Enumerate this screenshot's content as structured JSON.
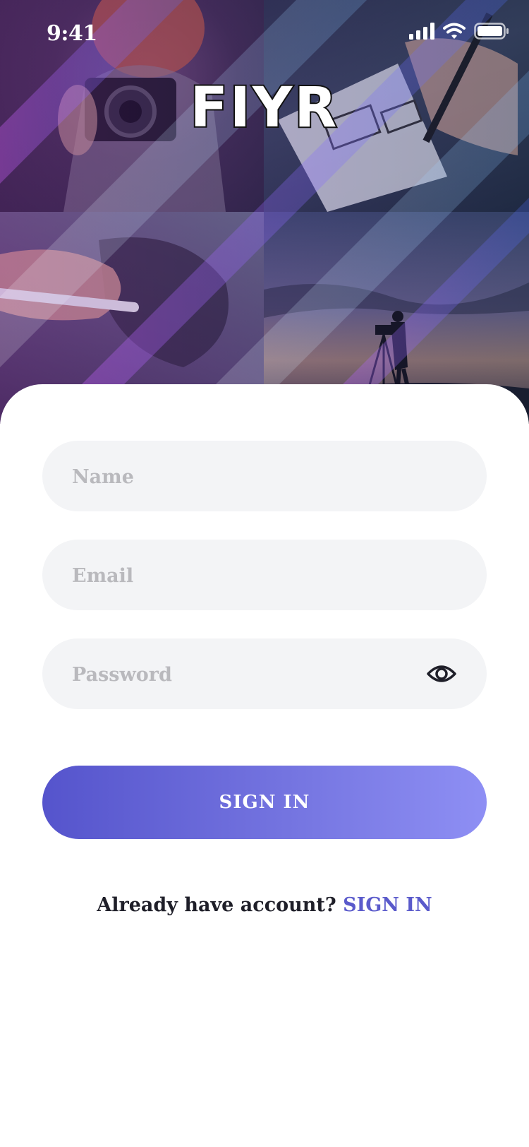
{
  "status_bar": {
    "time": "9:41",
    "icons": [
      "cellular-signal-icon",
      "wifi-icon",
      "battery-icon"
    ]
  },
  "hero": {
    "app_name": "FIYR",
    "photos": [
      "photographer-with-camera",
      "hand-sketching-wireframe",
      "hand-drawing-on-tablet",
      "silhouette-camera-tripod-sunset"
    ]
  },
  "form": {
    "name_placeholder": "Name",
    "email_placeholder": "Email",
    "password_placeholder": "Password",
    "show_password_icon": "eye-icon",
    "submit_label": "SIGN IN"
  },
  "footer": {
    "prompt": "Already have account?",
    "link_label": "SIGN IN"
  },
  "colors": {
    "accent": "#5a5acb",
    "button_gradient_start": "#5554cc",
    "button_gradient_end": "#8e8ff4",
    "field_background": "#f3f4f6",
    "placeholder": "#b9b9bd"
  }
}
